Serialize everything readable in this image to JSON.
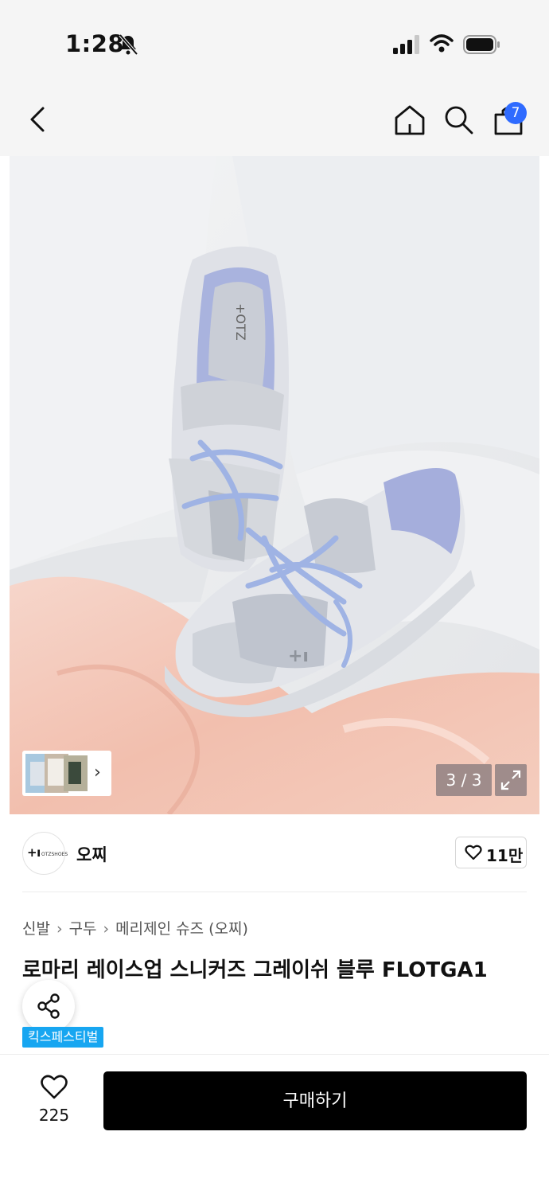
{
  "status_bar": {
    "time": "1:28"
  },
  "header": {
    "cart_count": "7"
  },
  "gallery": {
    "counter": "3 / 3"
  },
  "brand": {
    "name": "오찌",
    "logo_text": "+ı",
    "logo_sub": "OTZSHOES",
    "like_count": "11만"
  },
  "breadcrumb": {
    "items": [
      "신발",
      "구두",
      "메리제인 슈즈 (오찌)"
    ]
  },
  "product": {
    "title": "로마리 레이스업 스니커즈 그레이쉬 블루 FLOTGA1",
    "tag": "킥스페스티벌"
  },
  "bottom_bar": {
    "wish_count": "225",
    "buy_label": "구매하기"
  },
  "colors": {
    "badge_blue": "#2f6bff",
    "tag_blue": "#17a6f1",
    "buy_bg": "#000000"
  }
}
